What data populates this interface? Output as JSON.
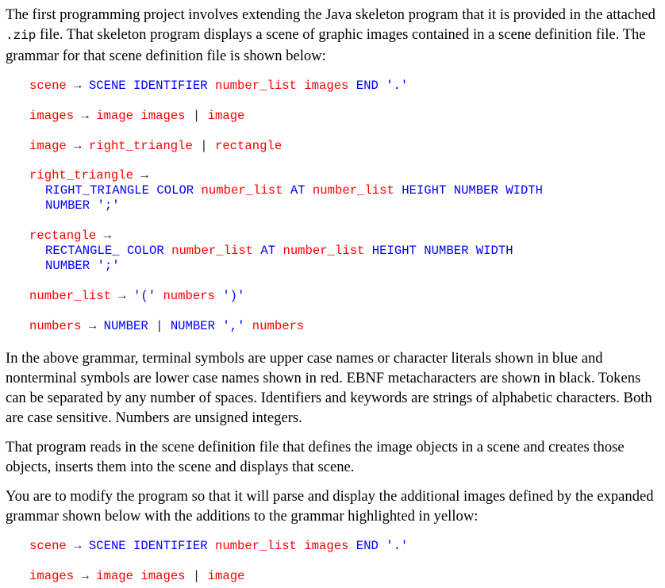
{
  "paragraphs": {
    "intro_1": "The first programming project involves extending the Java skeleton program that it is provided in the attached ",
    "intro_code": ".zip",
    "intro_2": " file. That skeleton program displays a scene of graphic images contained in a scene definition file. The grammar for that scene definition file is shown below:",
    "explain": "In the above grammar, terminal symbols are upper case names or character literals shown in blue and nonterminal symbols are lower case names shown in red. EBNF metacharacters are shown in black. Tokens can be separated by any number of spaces. Identifiers and keywords are strings of alphabetic characters. Both are case sensitive. Numbers are unsigned integers.",
    "reads": "That program reads in the scene definition file that defines the image objects in a scene and creates those objects, inserts them into the scene and displays that scene.",
    "modify": "You are to modify the program so that it will parse and display the additional images defined by the expanded grammar shown below with the additions to the grammar highlighted in yellow:"
  },
  "symbols": {
    "arrow": "→",
    "bar": "|",
    "scene": "scene",
    "SCENE": "SCENE",
    "IDENTIFIER": "IDENTIFIER",
    "number_list": "number_list",
    "images": "images",
    "END": "END",
    "dot": "'.'",
    "image": "image",
    "right_triangle": "right_triangle",
    "rectangle": "rectangle",
    "RIGHT_TRIANGLE": "RIGHT_TRIANGLE",
    "RECTANGLE": "RECTANGLE_",
    "COLOR": "COLOR",
    "AT": "AT",
    "HEIGHT": "HEIGHT",
    "NUMBER": "NUMBER",
    "WIDTH": "WIDTH",
    "semi": "';'",
    "lparen": "'('",
    "rparen": "')'",
    "comma": "','",
    "numbers": "numbers"
  },
  "colors": {
    "terminal": "#0000ff",
    "nonterminal": "#ff0000",
    "metachar": "#000000"
  }
}
